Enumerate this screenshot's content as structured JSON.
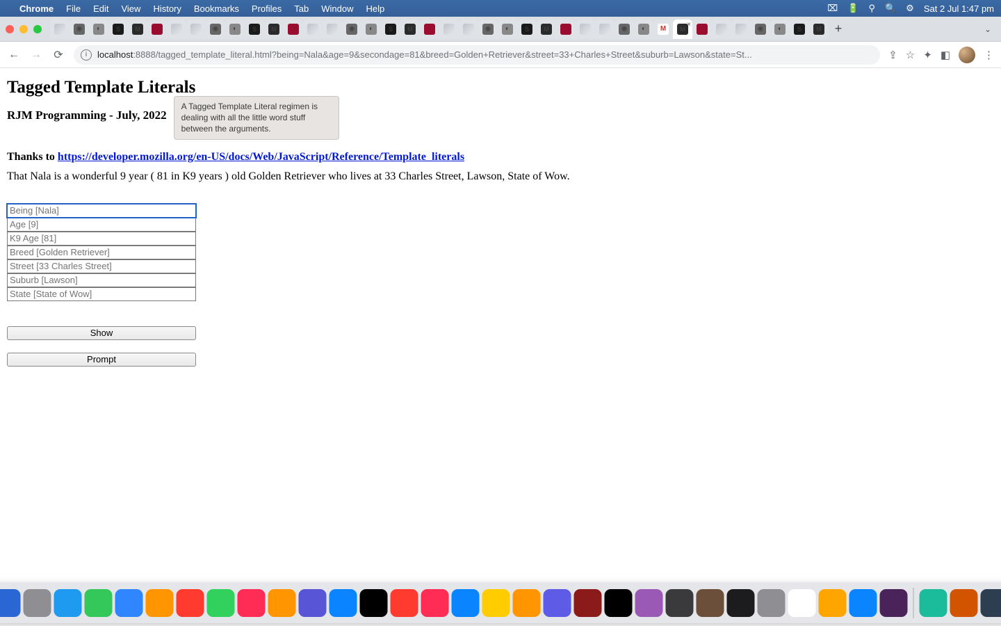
{
  "menubar": {
    "app": "Chrome",
    "items": [
      "File",
      "Edit",
      "View",
      "History",
      "Bookmarks",
      "Profiles",
      "Tab",
      "Window",
      "Help"
    ],
    "clock": "Sat 2 Jul  1:47 pm"
  },
  "url": {
    "host": "localhost",
    "path": ":8888/tagged_template_literal.html?being=Nala&age=9&secondage=81&breed=Golden+Retriever&street=33+Charles+Street&suburb=Lawson&state=St..."
  },
  "page": {
    "title": "Tagged Template Literals",
    "subtitle": "RJM Programming - July, 2022",
    "tooltip": "A Tagged Template Literal regimen is dealing with all the little word stuff between the arguments.",
    "thanks_prefix": "Thanks to ",
    "thanks_link": "https://developer.mozilla.org/en-US/docs/Web/JavaScript/Reference/Template_literals",
    "sentence": "That Nala is a wonderful 9 year ( 81 in K9 years ) old Golden Retriever who lives at 33 Charles Street, Lawson, State of Wow.",
    "inputs": [
      {
        "placeholder": "Being [Nala]"
      },
      {
        "placeholder": "Age [9]"
      },
      {
        "placeholder": "K9 Age [81]"
      },
      {
        "placeholder": "Breed [Golden Retriever]"
      },
      {
        "placeholder": "Street [33 Charles Street]"
      },
      {
        "placeholder": "Suburb [Lawson]"
      },
      {
        "placeholder": "State [State of Wow]"
      }
    ],
    "buttons": {
      "show": "Show",
      "prompt": "Prompt"
    }
  },
  "tabs": {
    "count": 40,
    "active_index": 32,
    "gmail_index": 31
  }
}
